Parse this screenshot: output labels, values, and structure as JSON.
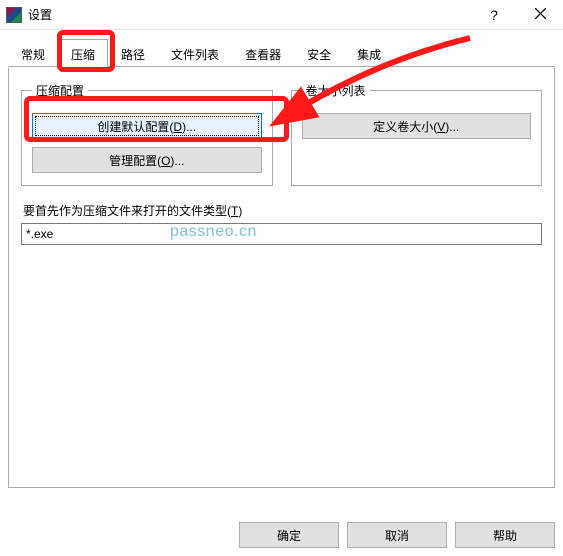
{
  "window": {
    "title": "设置"
  },
  "tabs": {
    "t0": "常规",
    "t1": "压缩",
    "t2": "路径",
    "t3": "文件列表",
    "t4": "查看器",
    "t5": "安全",
    "t6": "集成"
  },
  "groups": {
    "profiles": {
      "legend": "压缩配置",
      "create_prefix": "创建默认配置(",
      "create_key": "D",
      "create_suffix": ")...",
      "manage_prefix": "管理配置(",
      "manage_key": "O",
      "manage_suffix": ")..."
    },
    "volumes": {
      "legend": "卷大小列表",
      "define_prefix": "定义卷大小(",
      "define_key": "V",
      "define_suffix": ")..."
    }
  },
  "filetype": {
    "label_prefix": "要首先作为压缩文件来打开的文件类型(",
    "label_key": "T",
    "label_suffix": ")",
    "value": "*.exe"
  },
  "footer": {
    "ok": "确定",
    "cancel": "取消",
    "help": "帮助"
  },
  "watermark": "passneo.cn"
}
